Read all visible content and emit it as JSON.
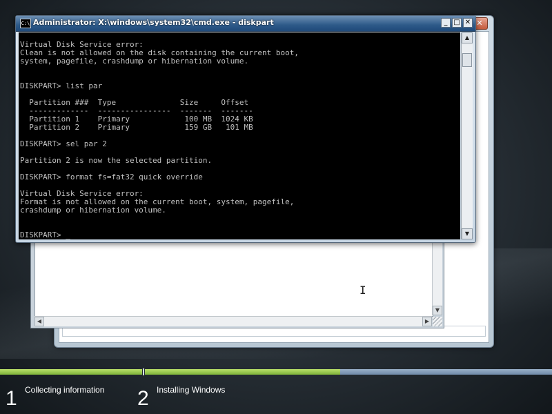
{
  "cmd": {
    "title": "Administrator: X:\\windows\\system32\\cmd.exe - diskpart",
    "icon_text": "C:\\",
    "controls": {
      "minimize": "_",
      "maximize": "□",
      "close": "✕"
    },
    "lines": [
      "",
      "Virtual Disk Service error:",
      "Clean is not allowed on the disk containing the current boot,",
      "system, pagefile, crashdump or hibernation volume.",
      "",
      "",
      "DISKPART> list par",
      "",
      "  Partition ###  Type              Size     Offset",
      "  -------------  ----------------  -------  -------",
      "  Partition 1    Primary            100 MB  1024 KB",
      "  Partition 2    Primary            159 GB   101 MB",
      "",
      "DISKPART> sel par 2",
      "",
      "Partition 2 is now the selected partition.",
      "",
      "DISKPART> format fs=fat32 quick override",
      "",
      "Virtual Disk Service error:",
      "Format is not allowed on the current boot, system, pagefile,",
      "crashdump or hibernation volume.",
      "",
      "",
      "DISKPART> _"
    ]
  },
  "setup": {
    "steps": [
      {
        "number": "1",
        "label": "Collecting information"
      },
      {
        "number": "2",
        "label": "Installing Windows"
      }
    ],
    "progress": {
      "step1_complete": 1.0,
      "step2_complete": 0.48
    }
  },
  "icons": {
    "scroll_up": "▲",
    "scroll_down": "▼",
    "scroll_left": "◀",
    "scroll_right": "▶",
    "ibeam": "I"
  },
  "colors": {
    "console_bg": "#000000",
    "console_fg": "#c0c0c0",
    "progress_done": "#8dc63f",
    "progress_pending": "#7f98b3"
  }
}
